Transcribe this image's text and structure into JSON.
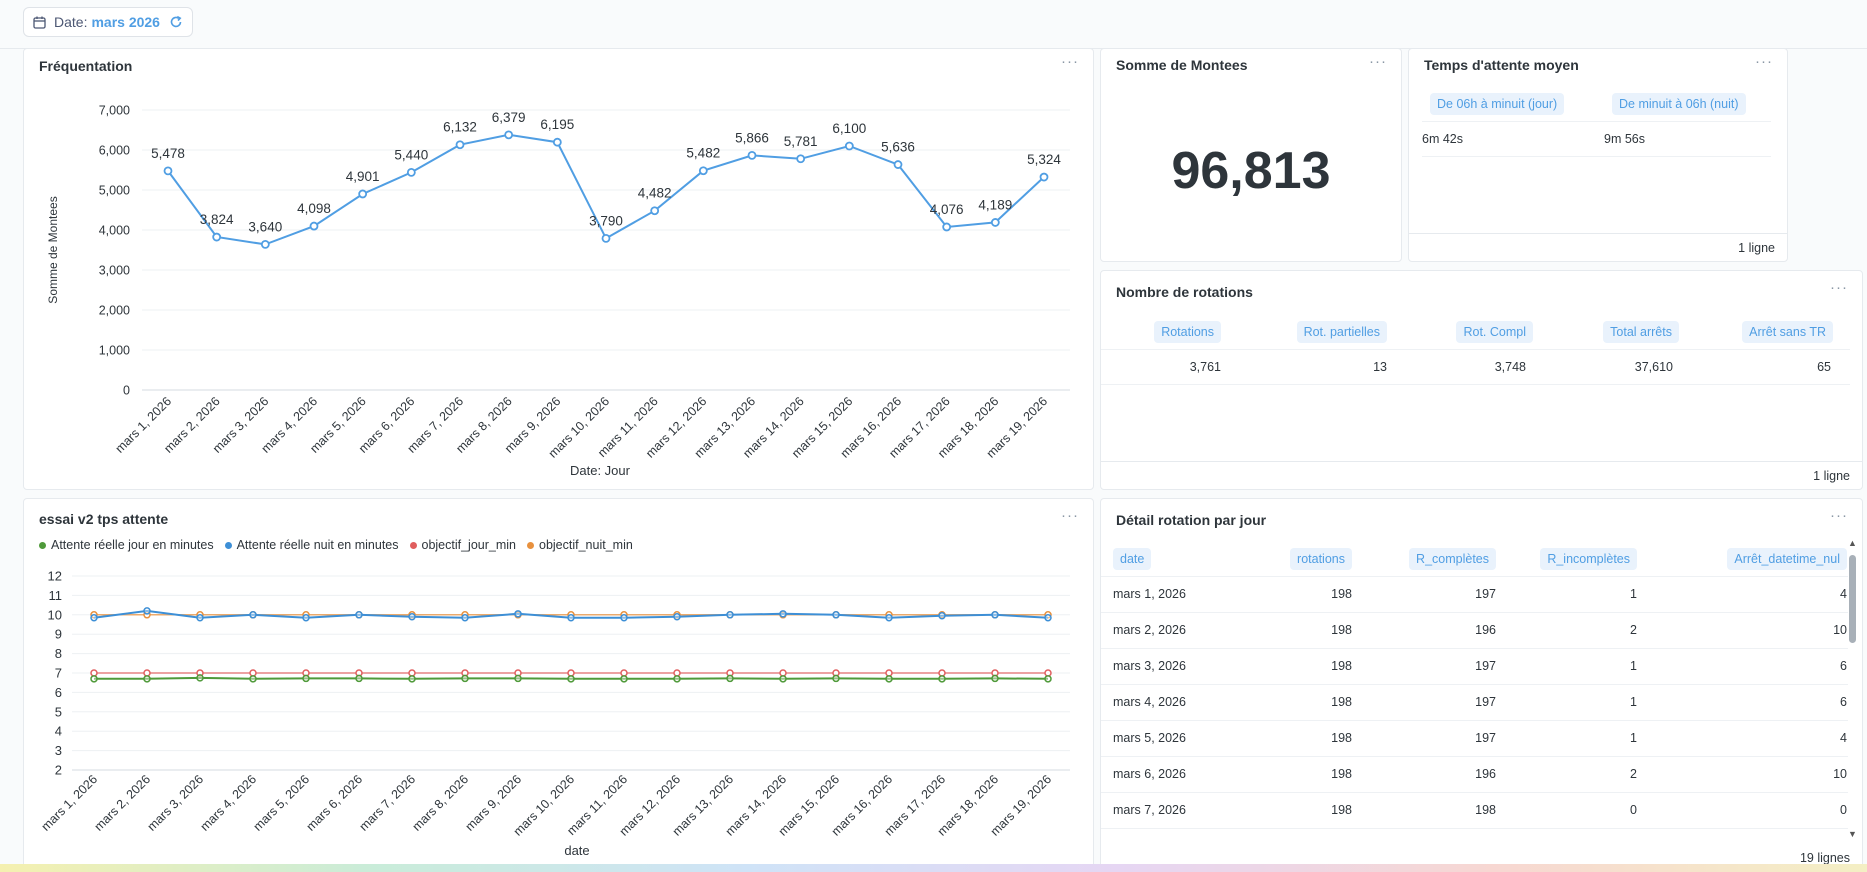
{
  "filter": {
    "label": "Date:",
    "value": "mars 2026"
  },
  "dates": [
    "mars 1, 2026",
    "mars 2, 2026",
    "mars 3, 2026",
    "mars 4, 2026",
    "mars 5, 2026",
    "mars 6, 2026",
    "mars 7, 2026",
    "mars 8, 2026",
    "mars 9, 2026",
    "mars 10, 2026",
    "mars 11, 2026",
    "mars 12, 2026",
    "mars 13, 2026",
    "mars 14, 2026",
    "mars 15, 2026",
    "mars 16, 2026",
    "mars 17, 2026",
    "mars 18, 2026",
    "mars 19, 2026"
  ],
  "frequentation": {
    "title": "Fréquentation",
    "menu": "···"
  },
  "somme": {
    "title": "Somme de Montees",
    "value": "96,813",
    "menu": "···"
  },
  "attente": {
    "title": "Temps d'attente moyen",
    "menu": "···",
    "columns": [
      "De 06h à minuit (jour)",
      "De minuit à 06h (nuit)"
    ],
    "row": [
      "6m 42s",
      "9m 56s"
    ],
    "footer": "1 ligne"
  },
  "rotations": {
    "title": "Nombre de rotations",
    "menu": "···",
    "columns": [
      "Rotations",
      "Rot. partielles",
      "Rot. Compl",
      "Total arrêts",
      "Arrêt sans TR"
    ],
    "row": [
      "3,761",
      "13",
      "3,748",
      "37,610",
      "65"
    ],
    "footer": "1 ligne"
  },
  "essai": {
    "title": "essai v2 tps attente",
    "menu": "···",
    "legend": [
      {
        "label": "Attente réelle jour en minutes",
        "color": "#4f9a3a"
      },
      {
        "label": "Attente réelle nuit en minutes",
        "color": "#3d8fd6"
      },
      {
        "label": "objectif_jour_min",
        "color": "#e05e5e"
      },
      {
        "label": "objectif_nuit_min",
        "color": "#e8913e"
      }
    ]
  },
  "detail": {
    "title": "Détail rotation par jour",
    "menu": "···",
    "columns": [
      "date",
      "rotations",
      "R_complètes",
      "R_incomplètes",
      "Arrêt_datetime_nul"
    ],
    "rows": [
      [
        "mars 1, 2026",
        "198",
        "197",
        "1",
        "4"
      ],
      [
        "mars 2, 2026",
        "198",
        "196",
        "2",
        "10"
      ],
      [
        "mars 3, 2026",
        "198",
        "197",
        "1",
        "6"
      ],
      [
        "mars 4, 2026",
        "198",
        "197",
        "1",
        "6"
      ],
      [
        "mars 5, 2026",
        "198",
        "197",
        "1",
        "4"
      ],
      [
        "mars 6, 2026",
        "198",
        "196",
        "2",
        "10"
      ],
      [
        "mars 7, 2026",
        "198",
        "198",
        "0",
        "0"
      ]
    ],
    "footer": "19 lignes"
  },
  "chart_data": [
    {
      "type": "line",
      "title": "Fréquentation",
      "xlabel": "Date: Jour",
      "ylabel": "Somme de Montees",
      "ylim": [
        0,
        7000
      ],
      "yticks": [
        "0",
        "1,000",
        "2,000",
        "3,000",
        "4,000",
        "5,000",
        "6,000",
        "7,000"
      ],
      "grid": true,
      "color": "#509ee3",
      "x": [
        "mars 1, 2026",
        "mars 2, 2026",
        "mars 3, 2026",
        "mars 4, 2026",
        "mars 5, 2026",
        "mars 6, 2026",
        "mars 7, 2026",
        "mars 8, 2026",
        "mars 9, 2026",
        "mars 10, 2026",
        "mars 11, 2026",
        "mars 12, 2026",
        "mars 13, 2026",
        "mars 14, 2026",
        "mars 15, 2026",
        "mars 16, 2026",
        "mars 17, 2026",
        "mars 18, 2026",
        "mars 19, 2026"
      ],
      "values": [
        5478,
        3824,
        3640,
        4098,
        4901,
        5440,
        6132,
        6379,
        6195,
        3790,
        4482,
        5482,
        5866,
        5781,
        6100,
        5636,
        4076,
        4189,
        5324
      ],
      "labels": [
        "5,478",
        "3,824",
        "3,640",
        "4,098",
        "4,901",
        "5,440",
        "6,132",
        "6,379",
        "6,195",
        "3,790",
        "4,482",
        "5,482",
        "5,866",
        "5,781",
        "6,100",
        "5,636",
        "4,076",
        "4,189",
        "5,324"
      ]
    },
    {
      "type": "line",
      "title": "essai v2 tps attente",
      "xlabel": "date",
      "ylabel": "",
      "ylim": [
        2,
        12
      ],
      "yticks": [
        "2",
        "3",
        "4",
        "5",
        "6",
        "7",
        "8",
        "9",
        "10",
        "11",
        "12"
      ],
      "grid": true,
      "legend": "top-left",
      "x": [
        "mars 1, 2026",
        "mars 2, 2026",
        "mars 3, 2026",
        "mars 4, 2026",
        "mars 5, 2026",
        "mars 6, 2026",
        "mars 7, 2026",
        "mars 8, 2026",
        "mars 9, 2026",
        "mars 10, 2026",
        "mars 11, 2026",
        "mars 12, 2026",
        "mars 13, 2026",
        "mars 14, 2026",
        "mars 15, 2026",
        "mars 16, 2026",
        "mars 17, 2026",
        "mars 18, 2026",
        "mars 19, 2026"
      ],
      "series": [
        {
          "name": "Attente réelle jour en minutes",
          "color": "#4f9a3a",
          "values": [
            6.7,
            6.7,
            6.75,
            6.7,
            6.72,
            6.72,
            6.7,
            6.72,
            6.72,
            6.7,
            6.7,
            6.7,
            6.72,
            6.7,
            6.72,
            6.7,
            6.7,
            6.72,
            6.7
          ]
        },
        {
          "name": "Attente réelle nuit en minutes",
          "color": "#3d8fd6",
          "values": [
            9.85,
            10.2,
            9.85,
            10.0,
            9.85,
            10.0,
            9.9,
            9.85,
            10.05,
            9.85,
            9.85,
            9.9,
            10.0,
            10.05,
            10.0,
            9.85,
            9.95,
            10.0,
            9.85
          ]
        },
        {
          "name": "objectif_jour_min",
          "color": "#e05e5e",
          "values": [
            7,
            7,
            7,
            7,
            7,
            7,
            7,
            7,
            7,
            7,
            7,
            7,
            7,
            7,
            7,
            7,
            7,
            7,
            7
          ]
        },
        {
          "name": "objectif_nuit_min",
          "color": "#e8913e",
          "values": [
            10,
            10,
            10,
            10,
            10,
            10,
            10,
            10,
            10,
            10,
            10,
            10,
            10,
            10,
            10,
            10,
            10,
            10,
            10
          ]
        }
      ]
    }
  ]
}
